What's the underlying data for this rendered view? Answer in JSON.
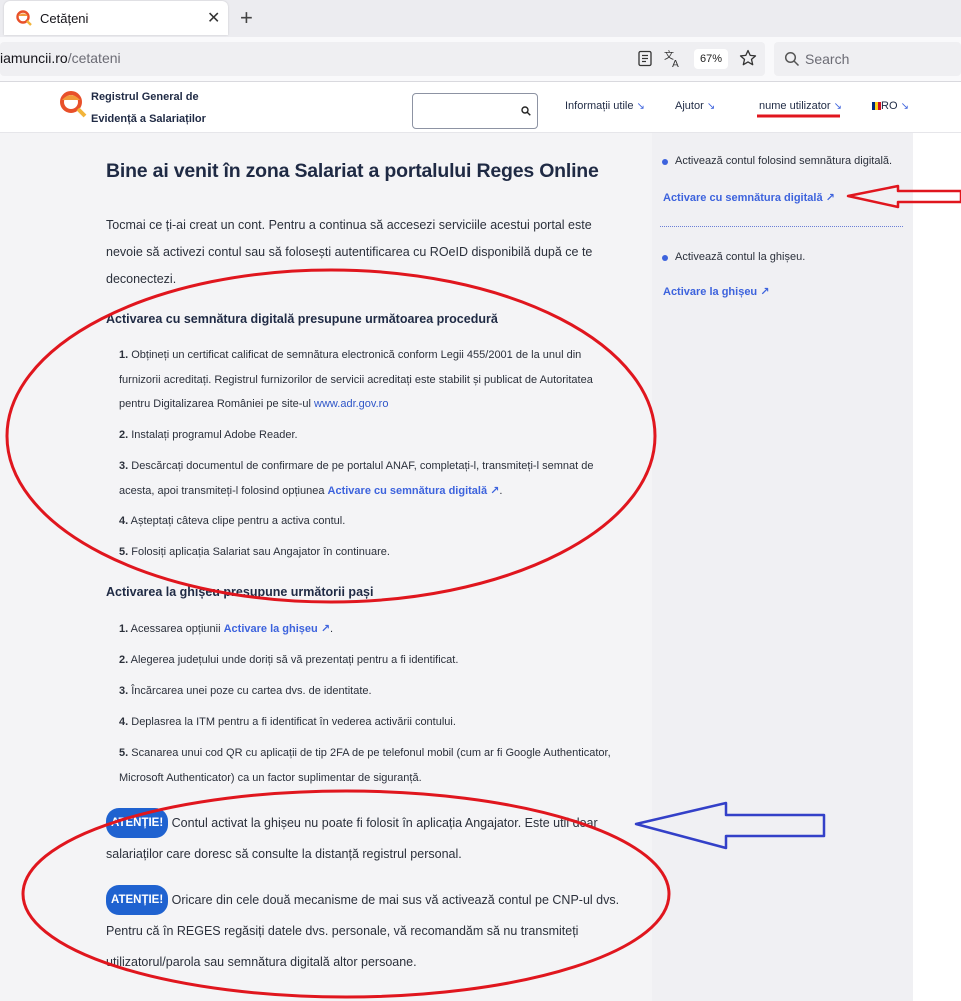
{
  "browser": {
    "tab_title": "Cetățeni",
    "tab_close": "✕",
    "new_tab": "+",
    "url_host": "iamuncii.ro",
    "url_path": "/cetateni",
    "zoom": "67%",
    "search_placeholder": "Search"
  },
  "header": {
    "brand_line1": "Registrul General de",
    "brand_line2": "Evidență a Salariaților",
    "nav": {
      "info": "Informații utile",
      "help": "Ajutor",
      "user": "nume utilizator",
      "lang": "RO",
      "arrow": "↘"
    }
  },
  "main": {
    "title": "Bine ai venit în zona Salariat a portalului Reges Online",
    "intro": "Tocmai ce ți-ai creat un cont. Pentru a continua să accesezi serviciile acestui portal este nevoie să activezi contul sau să folosești autentificarea cu ROeID disponibilă după ce te deconectezi.",
    "section1": {
      "heading": "Activarea cu semnătura digitală presupune următoarea procedură",
      "steps": [
        {
          "num": "1.",
          "text": "Obțineți un certificat calificat de semnătura electronică conform Legii 455/2001 de la unul din",
          "line2": "furnizorii acreditați. Registrul furnizorilor de servicii acreditați este stabilit și publicat de Autoritatea",
          "line3": "pentru Digitalizarea României pe site-ul ",
          "link": "www.adr.gov.ro"
        },
        {
          "num": "2.",
          "text": "Instalați programul Adobe Reader."
        },
        {
          "num": "3.",
          "text": "Descărcați documentul de confirmare de pe portalul ANAF, completați-l, transmiteți-l semnat de",
          "line2": "acesta, apoi transmiteți-l folosind opțiunea ",
          "link": "Activare cu semnătura digitală",
          "tail": "."
        },
        {
          "num": "4.",
          "text": "Așteptați câteva clipe pentru a activa contul."
        },
        {
          "num": "5.",
          "text": "Folosiți aplicația Salariat sau Angajator în continuare."
        }
      ]
    },
    "section2": {
      "heading": "Activarea la ghișeu presupune următorii pași",
      "steps": [
        {
          "num": "1.",
          "text": "Acessarea opțiunii ",
          "link": "Activare la ghișeu",
          "tail": "."
        },
        {
          "num": "2.",
          "text": "Alegerea județului unde doriți să vă prezentați pentru a fi identificat."
        },
        {
          "num": "3.",
          "text": "Încărcarea unei poze cu cartea dvs. de identitate."
        },
        {
          "num": "4.",
          "text": "Deplasrea la ITM pentru a fi identificat în vederea activării contului."
        },
        {
          "num": "5.",
          "text": "Scanarea unui cod QR cu aplicații de tip 2FA de pe telefonul mobil (cum ar fi Google Authenticator,",
          "line2": "Microsoft Authenticator) ca un factor suplimentar de siguranță."
        }
      ]
    },
    "notices": [
      {
        "badge": "ATENȚIE!",
        "text": " Contul activat la ghișeu nu poate fi folosit în aplicația Angajator. Este util doar salariaților care doresc să consulte la distanță registrul personal."
      },
      {
        "badge": "ATENȚIE!",
        "text": " Oricare din cele două mecanisme de mai sus vă activează contul pe CNP-ul dvs. Pentru că în REGES regăsiți datele dvs. personale, vă recomandăm să nu transmiteți utilizatorul/parola sau semnătura digitală altor persoane."
      }
    ],
    "link_arrow": "↗"
  },
  "sidebar": {
    "item1_text": "Activează contul folosind semnătura digitală.",
    "item1_link": "Activare cu semnătura digitală",
    "item2_text": "Activează contul la ghișeu.",
    "item2_link": "Activare la ghișeu"
  },
  "annotations": {
    "red": "#e0161e",
    "blue": "#3340c8"
  }
}
